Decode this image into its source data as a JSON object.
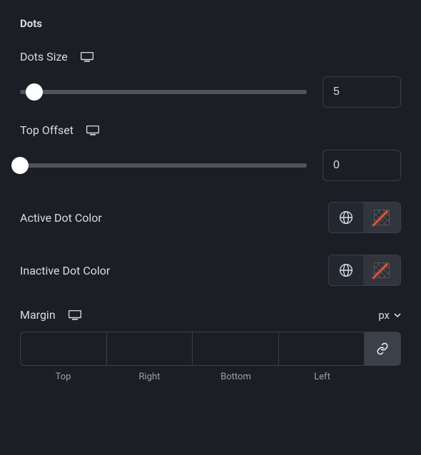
{
  "section": {
    "title": "Dots"
  },
  "dotsSize": {
    "label": "Dots Size",
    "value": "5",
    "thumb_pct": 5
  },
  "topOffset": {
    "label": "Top Offset",
    "value": "0",
    "thumb_pct": 0
  },
  "activeDotColor": {
    "label": "Active Dot Color"
  },
  "inactiveDotColor": {
    "label": "Inactive Dot Color"
  },
  "margin": {
    "label": "Margin",
    "unit": "px",
    "sides": {
      "top": "Top",
      "right": "Right",
      "bottom": "Bottom",
      "left": "Left"
    },
    "values": {
      "top": "",
      "right": "",
      "bottom": "",
      "left": ""
    }
  }
}
